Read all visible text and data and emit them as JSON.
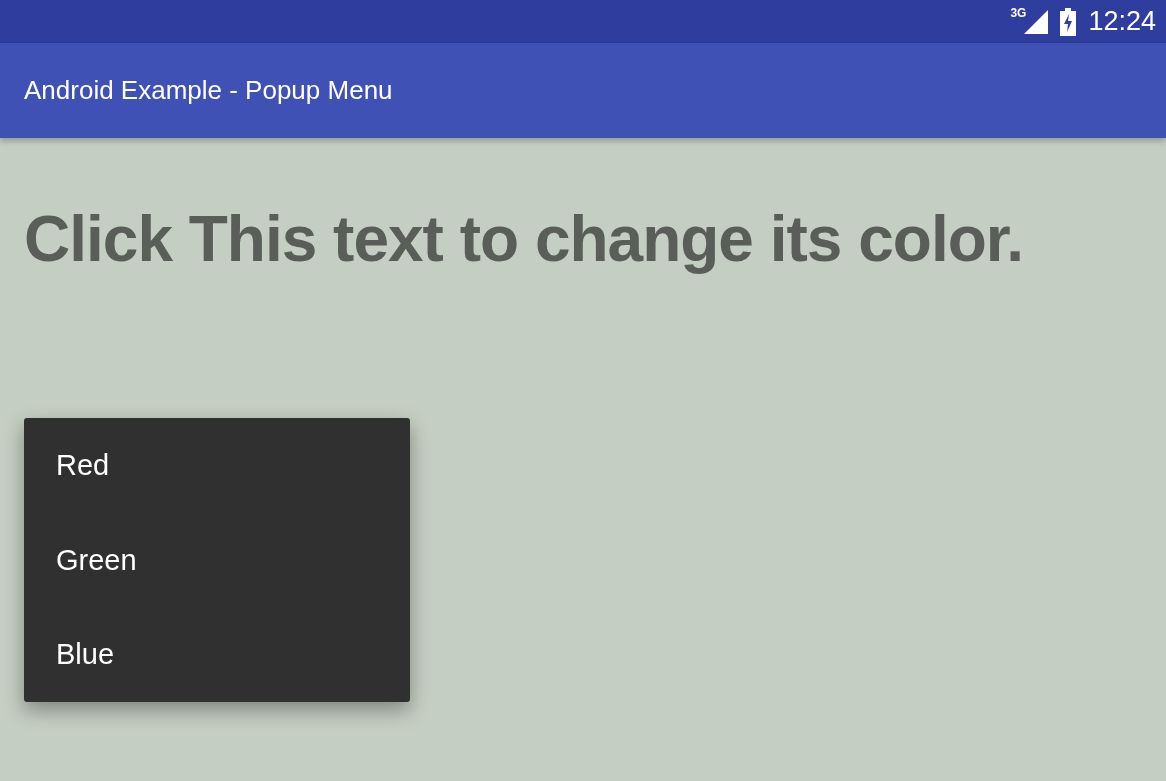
{
  "status_bar": {
    "network": "3G",
    "time": "12:24"
  },
  "app_bar": {
    "title": "Android Example - Popup Menu"
  },
  "content": {
    "text": "Click This text to change its color."
  },
  "popup_menu": {
    "items": [
      {
        "label": "Red"
      },
      {
        "label": "Green"
      },
      {
        "label": "Blue"
      }
    ]
  }
}
